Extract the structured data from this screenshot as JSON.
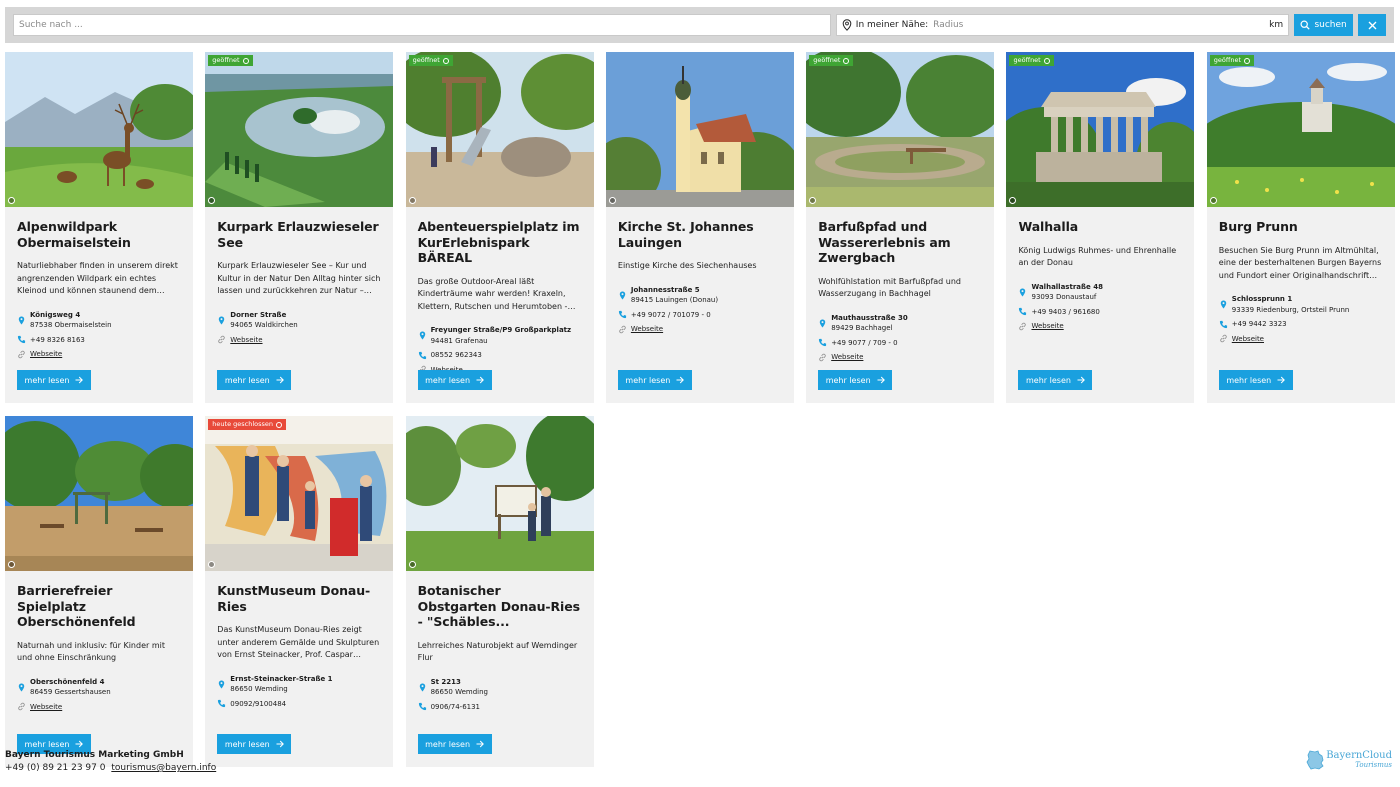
{
  "search": {
    "placeholder": "Suche nach ...",
    "near_label": "In meiner Nähe:",
    "radius_placeholder": "Radius",
    "unit": "km",
    "submit_label": "suchen"
  },
  "colors": {
    "accent": "#1aa0df",
    "badge_open": "#3fa534",
    "badge_closed": "#e84a3a",
    "card_bg": "#f1f1f1"
  },
  "cards": [
    {
      "title": "Alpenwildpark Obermaiselstein",
      "badge": "",
      "description": "Naturliebhaber finden in unserem direkt angrenzenden Wildpark ein echtes Kleinod und können staunend dem Wun…",
      "street": "Königsweg 4",
      "city": "87538 Obermaiselstein",
      "phone": "+49 8326 8163",
      "website": "Webseite",
      "more": "mehr lesen"
    },
    {
      "title": "Kurpark Erlauzwieseler See",
      "badge": "geöffnet",
      "description": "Kurpark Erlauzwieseler See – Kur und Kultur in der Natur Den Alltag hinter sich lassen und zurückkehren zur Natur – eine…",
      "street": "Dorner Straße",
      "city": "94065 Waldkirchen",
      "phone": "",
      "website": "Webseite",
      "more": "mehr lesen"
    },
    {
      "title": "Abenteuerspielplatz im KurErlebnispark BÄREAL",
      "badge": "geöffnet",
      "description": "Das große Outdoor-Areal läßt Kinderträume wahr werden! Kraxeln, Klettern, Rutschen und Herumtoben - dem Bewe…",
      "street": "Freyunger Straße/P9 Großparkplatz",
      "city": "94481 Grafenau",
      "phone": "08552 962343",
      "website": "Webseite",
      "more": "mehr lesen"
    },
    {
      "title": "Kirche St. Johannes Lauingen",
      "badge": "",
      "description": "Einstige Kirche des Siechenhauses",
      "street": "Johannesstraße 5",
      "city": "89415 Lauingen (Donau)",
      "phone": "+49 9072 / 701079 - 0",
      "website": "Webseite",
      "more": "mehr lesen"
    },
    {
      "title": "Barfußpfad und Wassererlebnis am Zwergbach",
      "badge": "geöffnet",
      "description": "Wohlfühlstation mit Barfußpfad und Wasserzugang in Bachhagel",
      "street": "Mauthausstraße 30",
      "city": "89429 Bachhagel",
      "phone": "+49 9077 / 709 - 0",
      "website": "Webseite",
      "more": "mehr lesen"
    },
    {
      "title": "Walhalla",
      "badge": "geöffnet",
      "description": "König Ludwigs Ruhmes- und Ehrenhalle an der Donau",
      "street": "Walhallastraße 48",
      "city": "93093 Donaustauf",
      "phone": "+49 9403 / 961680",
      "website": "Webseite",
      "more": "mehr lesen"
    },
    {
      "title": "Burg Prunn",
      "badge": "geöffnet",
      "description": "Besuchen Sie Burg Prunn im Altmühltal, eine der besterhaltenen Burgen Bayerns und Fundort einer Originalhandschrift de…",
      "street": "Schlossprunn 1",
      "city": "93339 Riedenburg, Ortsteil Prunn",
      "phone": "+49 9442 3323",
      "website": "Webseite",
      "more": "mehr lesen"
    },
    {
      "title": "Barrierefreier Spielplatz Oberschönenfeld",
      "badge": "",
      "description": "Naturnah und inklusiv: für Kinder mit und ohne Einschränkung",
      "street": "Oberschönenfeld 4",
      "city": "86459 Gessertshausen",
      "phone": "",
      "website": "Webseite",
      "more": "mehr lesen"
    },
    {
      "title": "KunstMuseum Donau-Ries",
      "badge": "heute geschlossen",
      "description": "Das KunstMuseum Donau-Ries zeigt unter anderem Gemälde und Skulpturen von Ernst Steinacker, Prof. Caspar Schlötter…",
      "street": "Ernst-Steinacker-Straße 1",
      "city": "86650 Wemding",
      "phone": "09092/9100484",
      "website": "",
      "more": "mehr lesen"
    },
    {
      "title": "Botanischer Obstgarten Donau-Ries - \"Schäbles...",
      "badge": "",
      "description": "Lehrreiches Naturobjekt auf Wemdinger Flur",
      "street": "St 2213",
      "city": "86650 Wemding",
      "phone": "0906/74-6131",
      "website": "",
      "more": "mehr lesen"
    }
  ],
  "footer": {
    "company": "Bayern Tourismus Marketing GmbH",
    "phone": "+49 (0) 89 21 23 97 0",
    "email": "tourismus@bayern.info"
  },
  "logo": {
    "line1": "BayernCloud",
    "line2": "Tourismus"
  }
}
